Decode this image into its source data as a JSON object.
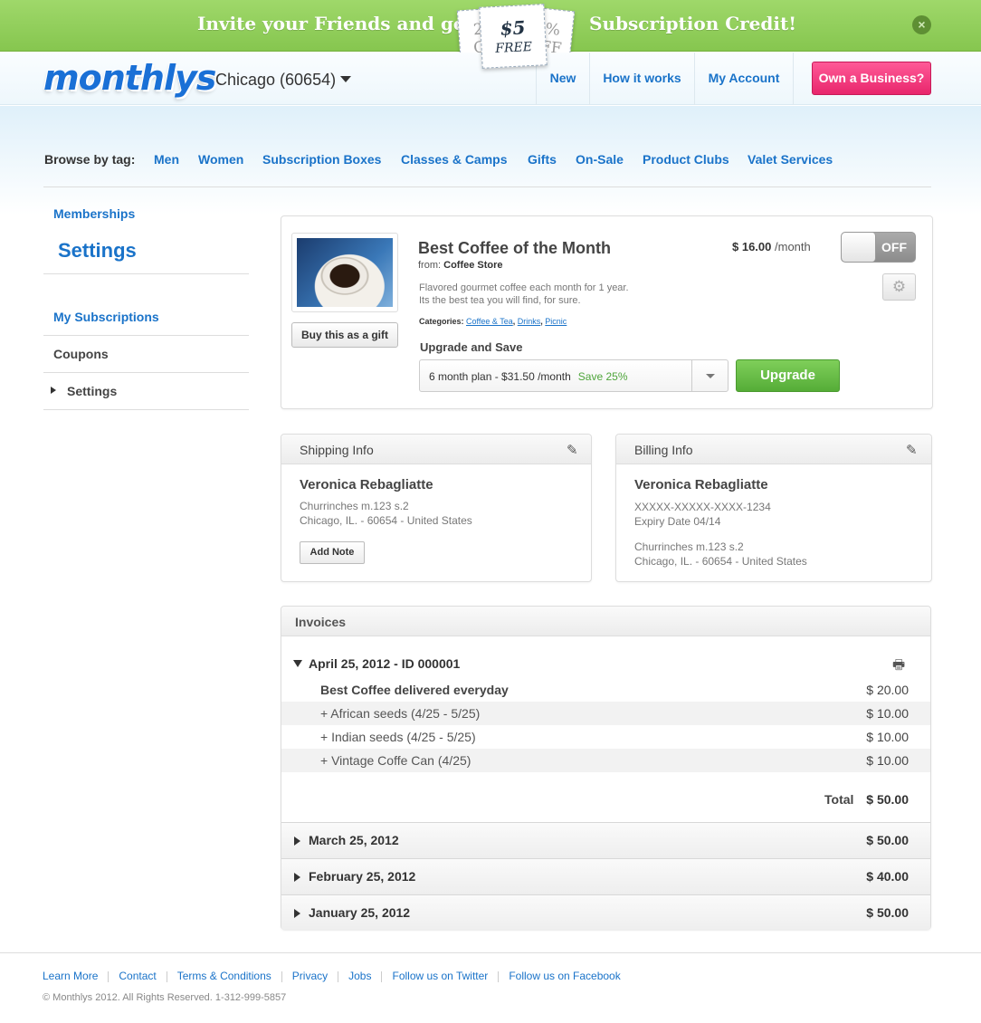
{
  "banner": {
    "left_text": "Invite your Friends and get",
    "right_text": "Subscription Credit!",
    "tag_price": "$5",
    "tag_free": "FREE",
    "tag_back_left": "2\nC",
    "tag_back_right": "%\nFF",
    "close_icon": "close-icon"
  },
  "header": {
    "logo": "monthlys",
    "city": "Chicago (60654)",
    "nav": [
      "New",
      "How it works",
      "My Account"
    ],
    "business_button": "Own a Business?"
  },
  "browse": {
    "label": "Browse by tag:",
    "tags": [
      "Men",
      "Women",
      "Subscription Boxes",
      "Classes & Camps",
      "Gifts",
      "On-Sale",
      "Product Clubs",
      "Valet Services"
    ]
  },
  "sidebar": {
    "memberships": "Memberships",
    "title": "Settings",
    "items": [
      "My Subscriptions",
      "Coupons",
      "Settings"
    ]
  },
  "product": {
    "title": "Best Coffee of the Month",
    "from_label": "from:",
    "from_store": "Coffee Store",
    "description_1": "Flavored gourmet coffee each month for 1 year.",
    "description_2": "Its the best tea you will find, for sure.",
    "categories_label": "Categories:",
    "categories": [
      "Coffee & Tea",
      "Drinks",
      "Picnic"
    ],
    "gift_button": "Buy this as a gift",
    "price": "$ 16.00",
    "price_unit": "/month",
    "toggle_state": "OFF",
    "upgrade_label": "Upgrade and Save",
    "plan_text": "6 month plan - $31.50 /month",
    "plan_save": "Save 25%",
    "upgrade_button": "Upgrade"
  },
  "shipping": {
    "title": "Shipping Info",
    "name": "Veronica Rebagliatte",
    "line1": "Churrinches m.123 s.2",
    "line2": "Chicago, IL. - 60654 - United States",
    "note_button": "Add Note"
  },
  "billing": {
    "title": "Billing Info",
    "name": "Veronica Rebagliatte",
    "card": "XXXXX-XXXXX-XXXX-1234",
    "expiry": "Expiry Date 04/14",
    "line1": "Churrinches m.123 s.2",
    "line2": "Chicago, IL. - 60654 - United States"
  },
  "invoices": {
    "title": "Invoices",
    "open": {
      "date": "April 25, 2012 - ID 000001",
      "rows": [
        {
          "label": "Best Coffee delivered everyday",
          "amount": "$ 20.00"
        },
        {
          "label": "+ African seeds (4/25 - 5/25)",
          "amount": "$ 10.00"
        },
        {
          "label": "+ Indian seeds (4/25 - 5/25)",
          "amount": "$ 10.00"
        },
        {
          "label": "+ Vintage Coffe Can (4/25)",
          "amount": "$ 10.00"
        }
      ],
      "total_label": "Total",
      "total": "$ 50.00"
    },
    "collapsed": [
      {
        "date": "March 25, 2012",
        "amount": "$ 50.00"
      },
      {
        "date": "February 25, 2012",
        "amount": "$ 40.00"
      },
      {
        "date": "January 25, 2012",
        "amount": "$ 50.00"
      }
    ]
  },
  "footer": {
    "links": [
      "Learn More",
      "Contact",
      "Terms & Conditions",
      "Privacy",
      "Jobs",
      "Follow us on Twitter",
      "Follow us on Facebook"
    ],
    "copyright": "© Monthlys 2012. All Rights Reserved. 1-312-999-5857"
  },
  "colors": {
    "banner_green": "#8fce58",
    "link_blue": "#1a73c9",
    "business_pink": "#f0357c",
    "upgrade_green": "#62bb44"
  }
}
